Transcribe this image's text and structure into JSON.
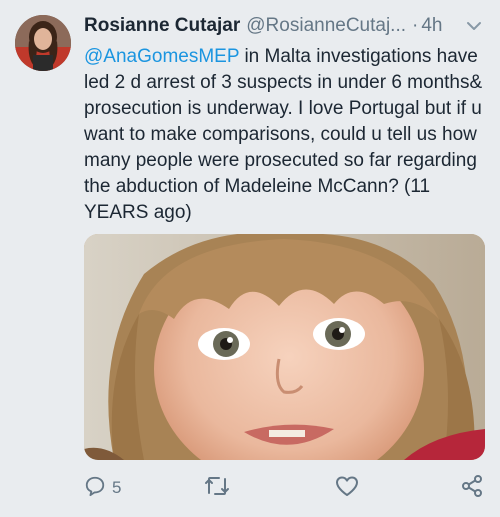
{
  "author": {
    "name": "Rosianne Cutajar",
    "handle": "@RosianneCutaj...",
    "separator": "·",
    "time": "4h"
  },
  "tweet": {
    "mention": "@AnaGomesMEP",
    "text": " in Malta investigations have led 2 d arrest of 3 suspects in under 6 months& prosecution is underway. I love Portugal but if u want to make comparisons, could u tell us how many people were prosecuted so far regarding the abduction of Madeleine McCann? (11 YEARS ago)"
  },
  "actions": {
    "reply_count": "5",
    "retweet_count": "",
    "like_count": ""
  },
  "icons": {
    "reply": "reply-icon",
    "retweet": "retweet-icon",
    "like": "heart-icon",
    "share": "share-icon",
    "menu": "chevron-down-icon"
  },
  "colors": {
    "background": "#e9ecef",
    "link": "#1b95e0",
    "secondary_text": "#657786",
    "primary_text": "#1c2733"
  }
}
